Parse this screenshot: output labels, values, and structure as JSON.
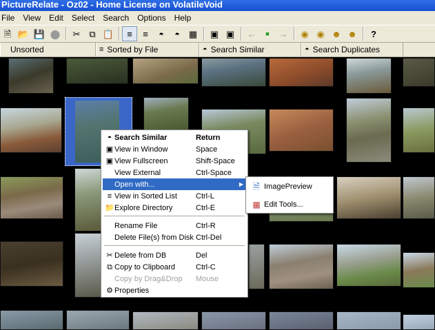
{
  "window": {
    "title": "PictureRelate - Oz02 - Home License on VolatileVoid"
  },
  "menubar": {
    "items": [
      "File",
      "View",
      "Edit",
      "Select",
      "Search",
      "Options",
      "Help"
    ]
  },
  "toolbar": {
    "icons": [
      "new-icon",
      "open-icon",
      "save-icon",
      "stop-icon",
      "cut-icon",
      "copy-icon",
      "paste-icon",
      "align-left-icon",
      "align-right-icon",
      "binoculars-icon",
      "binoculars-pair-icon",
      "grid-icon",
      "fit-window-icon",
      "fullscreen-icon",
      "back-arrow-icon",
      "stop-square-icon",
      "forward-arrow-icon",
      "eye-icon",
      "eye-search-icon",
      "face-search-icon",
      "face-settings-icon",
      "help-icon"
    ]
  },
  "tabs": [
    {
      "label": "Unsorted",
      "icon": ""
    },
    {
      "label": "Sorted by File",
      "icon": "list-icon"
    },
    {
      "label": "Search Similar",
      "icon": "binoculars-icon"
    },
    {
      "label": "Search Duplicates",
      "icon": "binoculars-pair-icon"
    }
  ],
  "context_menu": {
    "items": [
      {
        "label": "Search Similar",
        "shortcut": "Return",
        "icon": "binoculars-icon",
        "bold": true
      },
      {
        "label": "View in Window",
        "shortcut": "Space",
        "icon": "window-icon"
      },
      {
        "label": "View Fullscreen",
        "shortcut": "Shift-Space",
        "icon": "fullscreen-icon"
      },
      {
        "label": "View External",
        "shortcut": "Ctrl-Space",
        "icon": ""
      },
      {
        "label": "Open with...",
        "shortcut": "",
        "icon": "",
        "highlighted": true,
        "submenu": true
      },
      {
        "label": "View in Sorted List",
        "shortcut": "Ctrl-L",
        "icon": "list-icon"
      },
      {
        "label": "Explore Directory",
        "shortcut": "Ctrl-E",
        "icon": "folder-icon"
      },
      {
        "label": "Rename File",
        "shortcut": "Ctrl-R",
        "icon": ""
      },
      {
        "label": "Delete File(s) from Disk",
        "shortcut": "Ctrl-Del",
        "icon": ""
      },
      {
        "label": "Delete from DB",
        "shortcut": "Del",
        "icon": "scissors-icon"
      },
      {
        "label": "Copy to Clipboard",
        "shortcut": "Ctrl-C",
        "icon": "copy-icon"
      },
      {
        "label": "Copy by Drag&Drop",
        "shortcut": "Mouse",
        "icon": "",
        "disabled": true
      },
      {
        "label": "Properties",
        "shortcut": "",
        "icon": "properties-icon"
      }
    ]
  },
  "submenu": {
    "items": [
      {
        "label": "ImagePreview",
        "icon": "document-icon"
      },
      {
        "label": "Edit Tools...",
        "icon": "edit-tools-icon"
      }
    ]
  }
}
